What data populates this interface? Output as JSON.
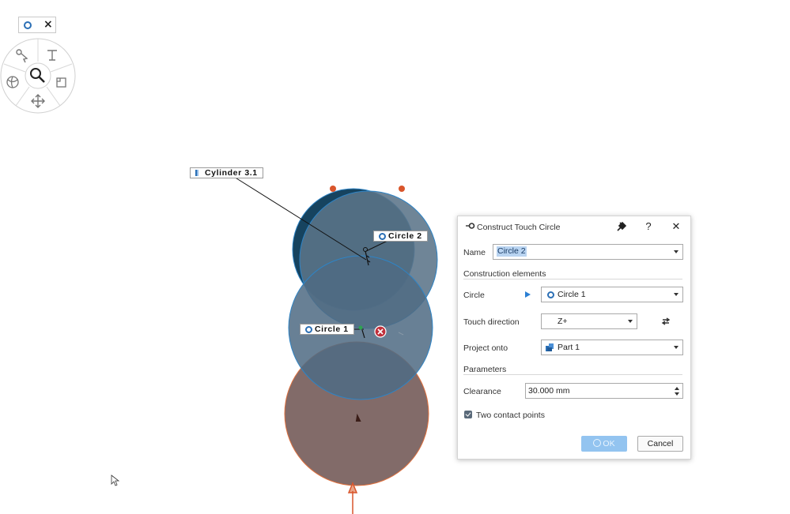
{
  "viewport": {
    "labels": {
      "cylinder": "Cylinder 3.1",
      "circle2": "Circle 2",
      "circle1": "Circle 1"
    },
    "colors": {
      "dark_circle": "#16435f",
      "blue_circle": "#4f6b83",
      "brown_circle": "#826b69",
      "outline_blue": "#2e84c6",
      "outline_orange": "#e0703d"
    },
    "radial_menu_icons": [
      "circle-icon",
      "close-icon",
      "select-icon",
      "text-icon",
      "globe-icon",
      "zoom-icon",
      "frame-icon",
      "move-icon"
    ]
  },
  "dialog": {
    "title": "Construct Touch Circle",
    "icons": [
      "pin-icon",
      "help-icon",
      "close-icon"
    ],
    "help_glyph": "?",
    "close_glyph": "✕",
    "name_label": "Name",
    "name_value": "Circle 2",
    "construction_section": "Construction elements",
    "circle_label": "Circle",
    "circle_value": "Circle 1",
    "touch_direction_label": "Touch direction",
    "touch_direction_value": "Z+",
    "project_onto_label": "Project onto",
    "project_onto_value": "Part 1",
    "parameters_section": "Parameters",
    "clearance_label": "Clearance",
    "clearance_value": "30.000 mm",
    "two_contact_label": "Two contact points",
    "two_contact_checked": true,
    "ok_label": "OK",
    "cancel_label": "Cancel"
  }
}
